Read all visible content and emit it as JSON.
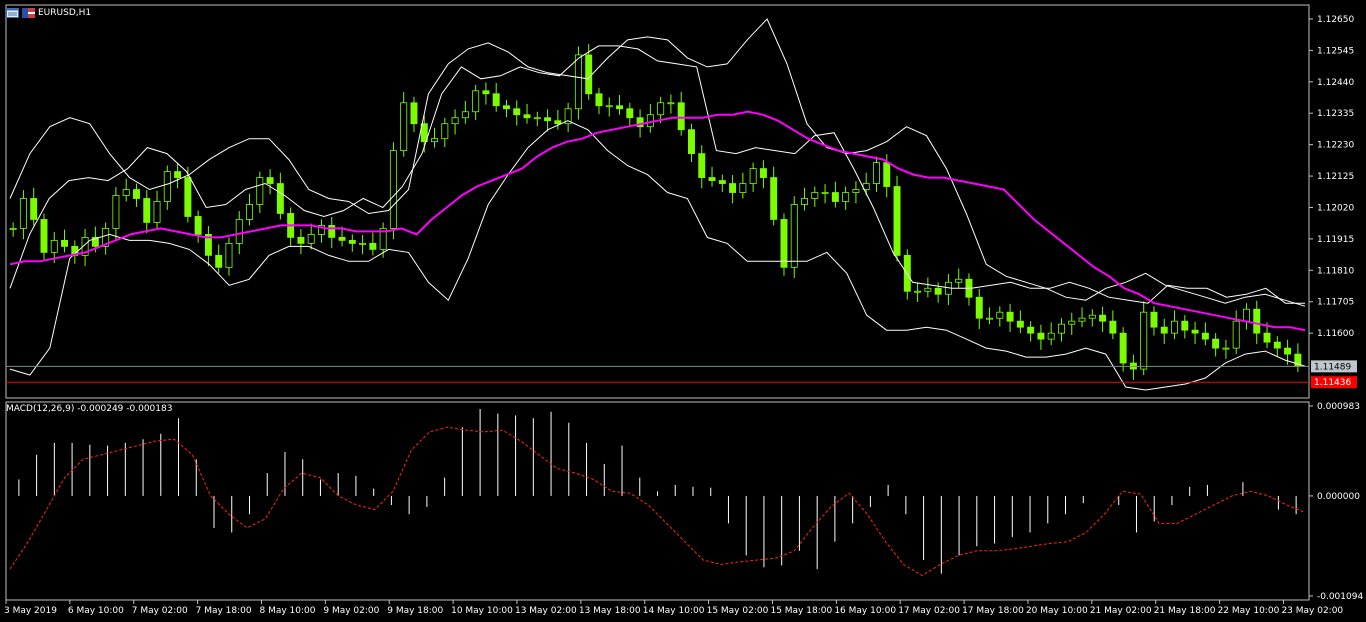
{
  "symbol": "EURUSD,H1",
  "macd_label": "MACD(12,26,9) -0.000249 -0.000183",
  "colors": {
    "background": "#000000",
    "candle": "#7CFC00",
    "bollinger": "#ffffff",
    "ma": "#ff00ff",
    "bid_line": "#7f8c8d",
    "price_label_bg": "#c0c7cc",
    "red_level": "#ff0000",
    "macd_hist": "#ffffff",
    "macd_signal": "#ff2020"
  },
  "chart_data": [
    {
      "type": "line",
      "ylim": [
        1.1141,
        1.1267
      ],
      "y_ticks": [
        "1.12650",
        "1.12545",
        "1.12440",
        "1.12335",
        "1.12230",
        "1.12125",
        "1.12020",
        "1.11915",
        "1.11810",
        "1.11705",
        "1.11600"
      ],
      "current_price": "1.11489",
      "red_level": "1.11436",
      "x_labels": [
        "3 May 2019",
        "6 May 10:00",
        "7 May 02:00",
        "7 May 18:00",
        "8 May 10:00",
        "9 May 02:00",
        "9 May 18:00",
        "10 May 10:00",
        "13 May 02:00",
        "13 May 18:00",
        "14 May 10:00",
        "15 May 02:00",
        "15 May 18:00",
        "16 May 10:00",
        "17 May 02:00",
        "17 May 18:00",
        "20 May 10:00",
        "21 May 02:00",
        "21 May 18:00",
        "22 May 10:00",
        "23 May 02:00"
      ],
      "series": [
        {
          "values": [
            1.1195,
            1.1205,
            1.1198,
            1.1187,
            1.1191,
            1.1189,
            1.1186,
            1.1192,
            1.1189,
            1.1195,
            1.1206,
            1.1208,
            1.1205,
            1.1197,
            1.1204,
            1.1214,
            1.1212,
            1.1199,
            1.1193,
            1.1186,
            1.1182,
            1.119,
            1.1198,
            1.1203,
            1.1212,
            1.121,
            1.12,
            1.1192,
            1.119,
            1.1193,
            1.1196,
            1.1192,
            1.1191,
            1.119,
            1.119,
            1.1188,
            1.1195,
            1.1221,
            1.1237,
            1.123,
            1.1224,
            1.1225,
            1.123,
            1.1232,
            1.1234,
            1.1241,
            1.124,
            1.1236,
            1.1235,
            1.1233,
            1.1232,
            1.1232,
            1.1231,
            1.123,
            1.1235,
            1.1253,
            1.124,
            1.1236,
            1.1236,
            1.1235,
            1.1232,
            1.1229,
            1.1233,
            1.1237,
            1.1237,
            1.1228,
            1.122,
            1.1212,
            1.1211,
            1.121,
            1.1207,
            1.121,
            1.1215,
            1.1212,
            1.1198,
            1.1182,
            1.1203,
            1.1205,
            1.1207,
            1.1207,
            1.1204,
            1.1207,
            1.1208,
            1.121,
            1.1217,
            1.1209,
            1.1186,
            1.1174,
            1.1174,
            1.1175,
            1.1173,
            1.1177,
            1.1178,
            1.1172,
            1.1165,
            1.1165,
            1.1167,
            1.1164,
            1.1162,
            1.116,
            1.1158,
            1.116,
            1.1163,
            1.1164,
            1.1165,
            1.1166,
            1.1164,
            1.116,
            1.115,
            1.1148,
            1.1167,
            1.1162,
            1.116,
            1.1164,
            1.1161,
            1.116,
            1.1158,
            1.1155,
            1.1155,
            1.1164,
            1.1168,
            1.116,
            1.1157,
            1.1155,
            1.1153,
            1.1149
          ]
        },
        {
          "values": [
            1.1183,
            1.1184,
            1.1184,
            1.1185,
            1.1186,
            1.1187,
            1.1189,
            1.1191,
            1.1193,
            1.1194,
            1.1195,
            1.1194,
            1.1193,
            1.1192,
            1.1192,
            1.1193,
            1.1194,
            1.1195,
            1.1196,
            1.1196,
            1.1196,
            1.1195,
            1.1195,
            1.1194,
            1.1194,
            1.1194,
            1.1195,
            1.1193,
            1.1198,
            1.1202,
            1.1206,
            1.1209,
            1.1211,
            1.1213,
            1.1215,
            1.1219,
            1.1222,
            1.1224,
            1.1225,
            1.1227,
            1.1228,
            1.1229,
            1.123,
            1.1231,
            1.1232,
            1.1232,
            1.1232,
            1.1233,
            1.1233,
            1.1234,
            1.1233,
            1.1231,
            1.1228,
            1.1225,
            1.1223,
            1.1221,
            1.122,
            1.1219,
            1.1218,
            1.1215,
            1.1213,
            1.1212,
            1.1212,
            1.1211,
            1.121,
            1.1209,
            1.1208,
            1.1203,
            1.1198,
            1.1194,
            1.119,
            1.1186,
            1.1182,
            1.1179,
            1.1175,
            1.1173,
            1.117,
            1.1169,
            1.1168,
            1.1167,
            1.1166,
            1.1165,
            1.1164,
            1.1163,
            1.1162,
            1.1162,
            1.1161
          ]
        },
        {
          "values": [
            1.1175,
            1.1193,
            1.1205,
            1.1211,
            1.1212,
            1.1211,
            1.1215,
            1.1222,
            1.122,
            1.1214,
            1.1202,
            1.1203,
            1.1208,
            1.121,
            1.1206,
            1.1201,
            1.1199,
            1.1201,
            1.1205,
            1.1202,
            1.1209,
            1.122,
            1.124,
            1.1249,
            1.1245,
            1.1246,
            1.1249,
            1.1247,
            1.1246,
            1.1252,
            1.1256,
            1.1256,
            1.1255,
            1.1251,
            1.125,
            1.1249,
            1.1221,
            1.122,
            1.1222,
            1.1221,
            1.122,
            1.1226,
            1.1227,
            1.1215,
            1.1202,
            1.1187,
            1.1177,
            1.1176,
            1.1175,
            1.1175,
            1.1176,
            1.1177,
            1.1175,
            1.1175,
            1.1177,
            1.1175,
            1.1172,
            1.1171,
            1.117,
            1.1176,
            1.1175,
            1.1175,
            1.1172,
            1.1173,
            1.1175,
            1.117,
            1.117
          ]
        },
        {
          "values": [
            1.1148,
            1.1146,
            1.1155,
            1.1185,
            1.1191,
            1.1193,
            1.1191,
            1.1191,
            1.119,
            1.1188,
            1.1183,
            1.1176,
            1.1178,
            1.1186,
            1.1189,
            1.1189,
            1.1186,
            1.1184,
            1.1184,
            1.1188,
            1.1187,
            1.1177,
            1.1171,
            1.1185,
            1.1203,
            1.1213,
            1.1222,
            1.1228,
            1.1231,
            1.1228,
            1.1221,
            1.1216,
            1.1213,
            1.1207,
            1.1205,
            1.1192,
            1.119,
            1.1184,
            1.1184,
            1.1184,
            1.1184,
            1.1187,
            1.118,
            1.1166,
            1.1161,
            1.1161,
            1.1162,
            1.1161,
            1.1158,
            1.1155,
            1.1154,
            1.1152,
            1.1152,
            1.1153,
            1.1155,
            1.1153,
            1.1142,
            1.1141,
            1.1142,
            1.1143,
            1.1145,
            1.115,
            1.1153,
            1.1154,
            1.1151,
            1.1149
          ]
        },
        {
          "values": [
            1.1205,
            1.122,
            1.1229,
            1.1232,
            1.123,
            1.122,
            1.1212,
            1.1208,
            1.121,
            1.1213,
            1.1218,
            1.1222,
            1.1225,
            1.1225,
            1.1218,
            1.1208,
            1.1205,
            1.1204,
            1.12,
            1.1201,
            1.1208,
            1.124,
            1.125,
            1.1255,
            1.1257,
            1.1254,
            1.1249,
            1.1247,
            1.1246,
            1.1245,
            1.1252,
            1.1258,
            1.1259,
            1.1258,
            1.1252,
            1.1249,
            1.125,
            1.1258,
            1.1265,
            1.125,
            1.123,
            1.1222,
            1.122,
            1.1221,
            1.1224,
            1.1229,
            1.1226,
            1.1215,
            1.12,
            1.1183,
            1.1179,
            1.1177,
            1.1175,
            1.1172,
            1.1171,
            1.1175,
            1.1177,
            1.118,
            1.1176,
            1.1174,
            1.1172,
            1.117,
            1.1172,
            1.1173,
            1.1171,
            1.1169
          ]
        }
      ]
    },
    {
      "type": "bar",
      "ylim": [
        -0.001094,
        0.000983
      ],
      "y_ticks": [
        "0.000983",
        "0.000000",
        "-0.001094"
      ],
      "series": [
        {
          "values": [
            0.00018,
            0.00045,
            0.00058,
            0.00058,
            0.00056,
            0.00055,
            0.00058,
            0.00062,
            0.00068,
            0.00085,
            0.0004,
            -0.00035,
            -0.0004,
            -0.0002,
            0.00025,
            0.00048,
            0.0004,
            0.00018,
            0.00025,
            0.00022,
            8e-05,
            -0.0001,
            -0.0002,
            -0.00012,
            0.0002,
            0.00075,
            0.00095,
            0.0009,
            0.00088,
            0.00085,
            0.00092,
            0.0008,
            0.00058,
            0.00035,
            0.00055,
            0.0002,
            5e-05,
            0.00012,
            0.0001,
            9e-05,
            -0.0003,
            -0.00065,
            -0.00078,
            -0.00076,
            -0.0006,
            -0.0008,
            -0.0005,
            -0.0003,
            -0.00012,
            0.00012,
            -0.0002,
            -0.0007,
            -0.00085,
            -0.00065,
            -0.00055,
            -0.00052,
            -0.00045,
            -0.0004,
            -0.0003,
            -0.0002,
            -8e-05,
            0.0,
            -0.0001,
            -0.0004,
            -0.00028,
            -0.0001,
            0.0001,
            0.00012,
            0.0,
            0.00015,
            0.0,
            -0.00015,
            -0.0002
          ]
        },
        {
          "values": [
            -0.0008,
            -0.0005,
            -0.00015,
            0.0002,
            0.0004,
            0.00045,
            0.0005,
            0.00055,
            0.0006,
            0.00062,
            0.00045,
            0.0,
            -0.0002,
            -0.00035,
            -0.00025,
            8e-05,
            0.00025,
            0.0002,
            0.0,
            -0.0001,
            -0.00015,
            5e-05,
            0.0005,
            0.0007,
            0.00075,
            0.00072,
            0.0007,
            0.00072,
            0.0006,
            0.00045,
            0.0003,
            0.00025,
            0.00018,
            5e-05,
            3e-05,
            -0.0001,
            -0.0003,
            -0.0005,
            -0.0007,
            -0.00075,
            -0.00072,
            -0.0007,
            -0.00068,
            -0.0006,
            -0.00035,
            -0.00012,
            3e-05,
            -0.0002,
            -0.0005,
            -0.00075,
            -0.00087,
            -0.00075,
            -0.00065,
            -0.0006,
            -0.0006,
            -0.00058,
            -0.00055,
            -0.00052,
            -0.0005,
            -0.0004,
            -0.0002,
            5e-05,
            2e-05,
            -0.0003,
            -0.0003,
            -0.0002,
            -0.0001,
            0.0,
            5e-05,
            0.0,
            -0.0001,
            -0.00018
          ]
        }
      ]
    }
  ]
}
